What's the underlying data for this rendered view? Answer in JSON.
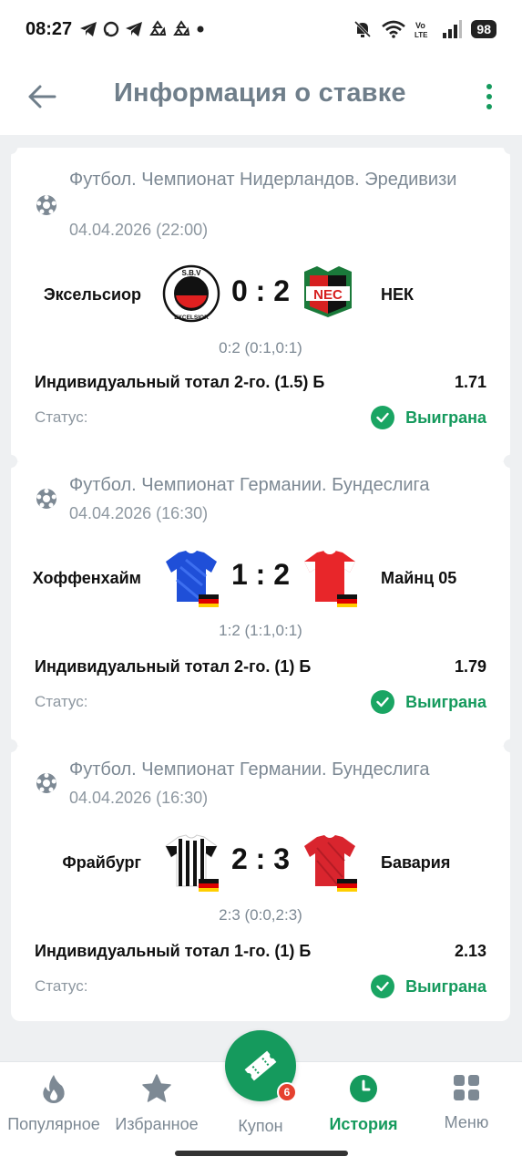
{
  "status_bar": {
    "time": "08:27",
    "battery": "98",
    "icons": [
      "telegram-icon",
      "chat-icon",
      "telegram-icon",
      "recycle-icon",
      "recycle-icon",
      "dot-icon",
      "mute-icon",
      "wifi-icon",
      "volte-icon",
      "signal-icon"
    ]
  },
  "header": {
    "title": "Информация о ставке"
  },
  "cards": [
    {
      "league": "Футбол. Чемпионат Нидерландов. Эредивизи",
      "date": "04.04.2026 (22:00)",
      "home": "Эксельсиор",
      "away": "НЕК",
      "score": "0 : 2",
      "detail": "0:2 (0:1,0:1)",
      "bet": "Индивидуальный тотал 2-го. (1.5) Б",
      "odds": "1.71",
      "status_label": "Статус:",
      "status": "Выиграна",
      "home_logo": "excelsior-logo",
      "away_logo": "nec-logo"
    },
    {
      "league": "Футбол. Чемпионат Германии. Бундеслига",
      "date": "04.04.2026 (16:30)",
      "home": "Хоффенхайм",
      "away": "Майнц 05",
      "score": "1 : 2",
      "detail": "1:2 (1:1,0:1)",
      "bet": "Индивидуальный тотал 2-го. (1) Б",
      "odds": "1.79",
      "status_label": "Статус:",
      "status": "Выиграна",
      "home_logo": "blue-jersey",
      "away_logo": "red-white-jersey"
    },
    {
      "league": "Футбол. Чемпионат Германии. Бундеслига",
      "date": "04.04.2026 (16:30)",
      "home": "Фрайбург",
      "away": "Бавария",
      "score": "2 : 3",
      "detail": "2:3 (0:0,2:3)",
      "bet": "Индивидуальный тотал 1-го. (1) Б",
      "odds": "2.13",
      "status_label": "Статус:",
      "status": "Выиграна",
      "home_logo": "black-white-striped-jersey",
      "away_logo": "red-jersey"
    }
  ],
  "excelsior_logo_text": "S.B.V EXCELSIOR",
  "nec_logo_text": "NEC",
  "nav": {
    "popular": "Популярное",
    "favorites": "Избранное",
    "coupon": "Купон",
    "coupon_badge": "6",
    "history": "История",
    "menu": "Меню"
  },
  "colors": {
    "accent": "#159a5d",
    "badge": "#e5412f",
    "title": "#6f7e8a"
  }
}
